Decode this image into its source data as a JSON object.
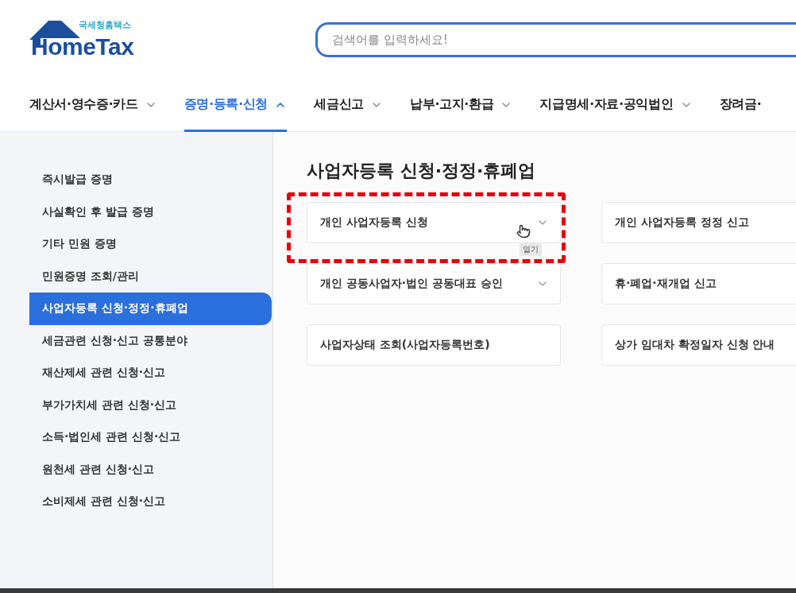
{
  "logo": {
    "name": "HomeTax",
    "subtitle": "국세청홈택스"
  },
  "search": {
    "placeholder": "검색어를 입력하세요!"
  },
  "nav": [
    {
      "label": "계산서·영수증·카드",
      "selected": false
    },
    {
      "label": "증명·등록·신청",
      "selected": true
    },
    {
      "label": "세금신고",
      "selected": false
    },
    {
      "label": "납부·고지·환급",
      "selected": false
    },
    {
      "label": "지급명세·자료·공익법인",
      "selected": false
    },
    {
      "label": "장려금·",
      "selected": false
    }
  ],
  "sidebar": {
    "items": [
      {
        "label": "즉시발급 증명",
        "selected": false
      },
      {
        "label": "사실확인 후 발급 증명",
        "selected": false
      },
      {
        "label": "기타 민원 증명",
        "selected": false
      },
      {
        "label": "민원증명 조회/관리",
        "selected": false
      },
      {
        "label": "사업자등록 신청·정정·휴폐업",
        "selected": true
      },
      {
        "label": "세금관련 신청·신고 공통분야",
        "selected": false
      },
      {
        "label": "재산제세 관련 신청·신고",
        "selected": false
      },
      {
        "label": "부가가치세 관련 신청·신고",
        "selected": false
      },
      {
        "label": "소득·법인세 관련 신청·신고",
        "selected": false
      },
      {
        "label": "원천세 관련 신청·신고",
        "selected": false
      },
      {
        "label": "소비제세 관련 신청·신고",
        "selected": false
      }
    ]
  },
  "section": {
    "title": "사업자등록 신청·정정·휴폐업",
    "cards": [
      {
        "label": "개인 사업자등록 신청",
        "kind": "dropdown",
        "annotation": {
          "tooltip": "열기"
        }
      },
      {
        "label": "개인 사업자등록 정정 신고",
        "kind": "link"
      },
      {
        "label": "개인 공동사업자·법인 공동대표 승인",
        "kind": "dropdown"
      },
      {
        "label": "휴·폐업·재개업 신고",
        "kind": "link"
      },
      {
        "label": "사업자상태 조회(사업자등록번호)",
        "kind": "link"
      },
      {
        "label": "상가 임대차 확정일자 신청 안내",
        "kind": "link"
      }
    ]
  }
}
